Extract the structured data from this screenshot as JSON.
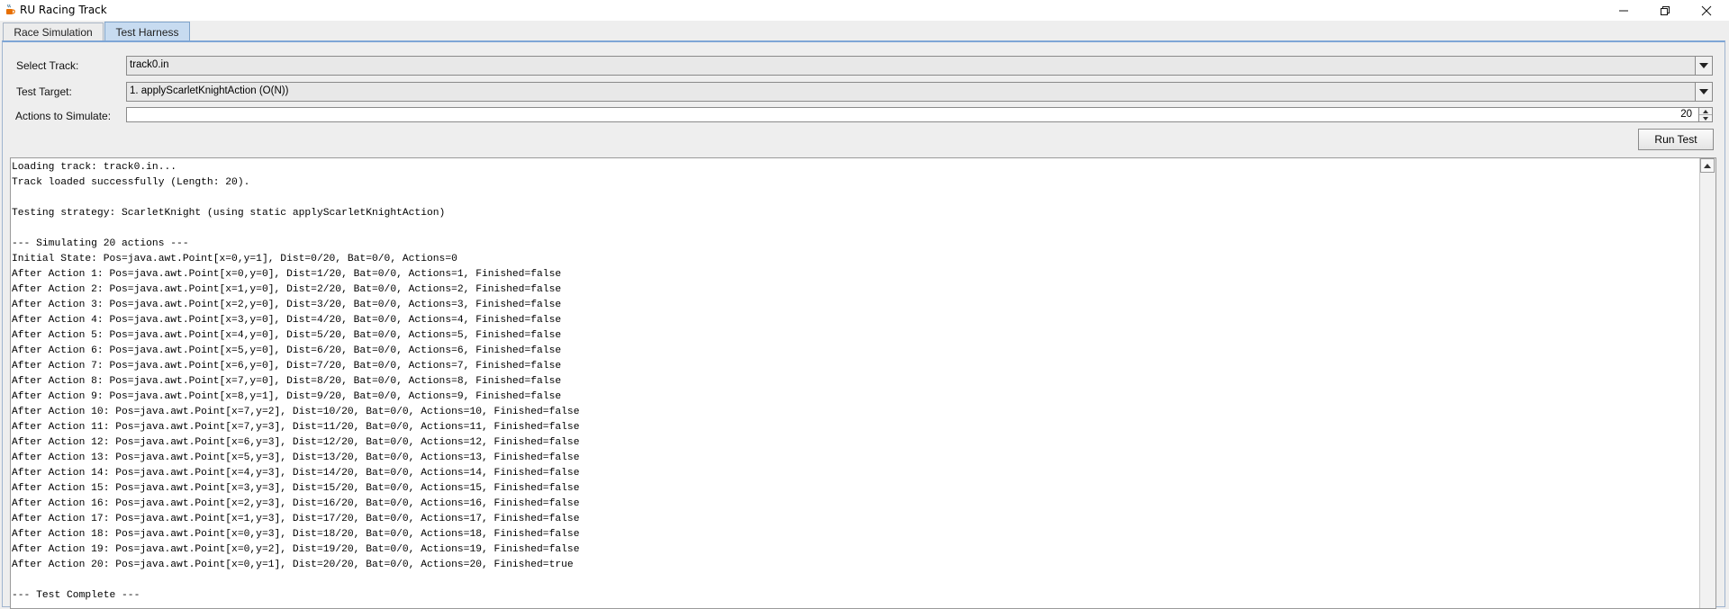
{
  "window": {
    "title": "RU Racing Track",
    "icon": "java-cup-icon"
  },
  "tabs": [
    {
      "label": "Race Simulation",
      "active": false
    },
    {
      "label": "Test Harness",
      "active": true
    }
  ],
  "form": {
    "track_label": "Select Track:",
    "track_value": "track0.in",
    "target_label": "Test Target:",
    "target_value": "1. applyScarletKnightAction (O(N))",
    "actions_label": "Actions to Simulate:",
    "actions_value": "20",
    "run_button": "Run Test"
  },
  "console": {
    "lines": [
      "Loading track: track0.in...",
      "Track loaded successfully (Length: 20).",
      "",
      "Testing strategy: ScarletKnight (using static applyScarletKnightAction)",
      "",
      "--- Simulating 20 actions ---",
      "Initial State: Pos=java.awt.Point[x=0,y=1], Dist=0/20, Bat=0/0, Actions=0",
      "After Action 1: Pos=java.awt.Point[x=0,y=0], Dist=1/20, Bat=0/0, Actions=1, Finished=false",
      "After Action 2: Pos=java.awt.Point[x=1,y=0], Dist=2/20, Bat=0/0, Actions=2, Finished=false",
      "After Action 3: Pos=java.awt.Point[x=2,y=0], Dist=3/20, Bat=0/0, Actions=3, Finished=false",
      "After Action 4: Pos=java.awt.Point[x=3,y=0], Dist=4/20, Bat=0/0, Actions=4, Finished=false",
      "After Action 5: Pos=java.awt.Point[x=4,y=0], Dist=5/20, Bat=0/0, Actions=5, Finished=false",
      "After Action 6: Pos=java.awt.Point[x=5,y=0], Dist=6/20, Bat=0/0, Actions=6, Finished=false",
      "After Action 7: Pos=java.awt.Point[x=6,y=0], Dist=7/20, Bat=0/0, Actions=7, Finished=false",
      "After Action 8: Pos=java.awt.Point[x=7,y=0], Dist=8/20, Bat=0/0, Actions=8, Finished=false",
      "After Action 9: Pos=java.awt.Point[x=8,y=1], Dist=9/20, Bat=0/0, Actions=9, Finished=false",
      "After Action 10: Pos=java.awt.Point[x=7,y=2], Dist=10/20, Bat=0/0, Actions=10, Finished=false",
      "After Action 11: Pos=java.awt.Point[x=7,y=3], Dist=11/20, Bat=0/0, Actions=11, Finished=false",
      "After Action 12: Pos=java.awt.Point[x=6,y=3], Dist=12/20, Bat=0/0, Actions=12, Finished=false",
      "After Action 13: Pos=java.awt.Point[x=5,y=3], Dist=13/20, Bat=0/0, Actions=13, Finished=false",
      "After Action 14: Pos=java.awt.Point[x=4,y=3], Dist=14/20, Bat=0/0, Actions=14, Finished=false",
      "After Action 15: Pos=java.awt.Point[x=3,y=3], Dist=15/20, Bat=0/0, Actions=15, Finished=false",
      "After Action 16: Pos=java.awt.Point[x=2,y=3], Dist=16/20, Bat=0/0, Actions=16, Finished=false",
      "After Action 17: Pos=java.awt.Point[x=1,y=3], Dist=17/20, Bat=0/0, Actions=17, Finished=false",
      "After Action 18: Pos=java.awt.Point[x=0,y=3], Dist=18/20, Bat=0/0, Actions=18, Finished=false",
      "After Action 19: Pos=java.awt.Point[x=0,y=2], Dist=19/20, Bat=0/0, Actions=19, Finished=false",
      "After Action 20: Pos=java.awt.Point[x=0,y=1], Dist=20/20, Bat=0/0, Actions=20, Finished=true",
      "",
      "--- Test Complete ---"
    ]
  },
  "colors": {
    "active_tab": "#c7dbf0",
    "panel_border": "#7ea6d6"
  }
}
